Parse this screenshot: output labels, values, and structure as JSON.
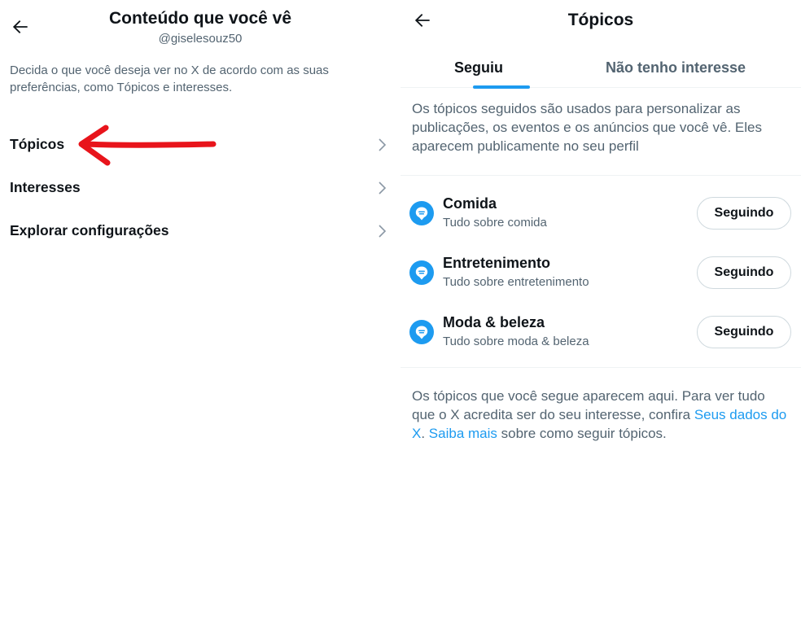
{
  "left": {
    "title": "Conteúdo que você vê",
    "handle": "@giselesouz50",
    "description": "Decida o que você deseja ver no X de acordo com as suas preferências, como Tópicos e interesses.",
    "menu": [
      {
        "label": "Tópicos"
      },
      {
        "label": "Interesses"
      },
      {
        "label": "Explorar configurações"
      }
    ],
    "annotation_color": "#e8141b"
  },
  "right": {
    "title": "Tópicos",
    "tabs": [
      {
        "label": "Seguiu",
        "active": true
      },
      {
        "label": "Não tenho interesse",
        "active": false
      }
    ],
    "description": "Os tópicos seguidos são usados para personalizar as publicações, os eventos e os anúncios que você vê. Eles aparecem publicamente no seu perfil",
    "topics": [
      {
        "name": "Comida",
        "subtitle": "Tudo sobre comida",
        "button": "Seguindo"
      },
      {
        "name": "Entretenimento",
        "subtitle": "Tudo sobre entretenimento",
        "button": "Seguindo"
      },
      {
        "name": "Moda & beleza",
        "subtitle": "Tudo sobre moda & beleza",
        "button": "Seguindo"
      }
    ],
    "footer": {
      "text1": "Os tópicos que você segue aparecem aqui. Para ver tudo que o X acredita ser do seu interesse, confira ",
      "link1": "Seus dados do X",
      "text2": ". ",
      "link2": "Saiba mais",
      "text3": " sobre como seguir tópicos."
    },
    "accent": "#1d9bf0",
    "topic_icon": "topic-bubble-icon"
  }
}
